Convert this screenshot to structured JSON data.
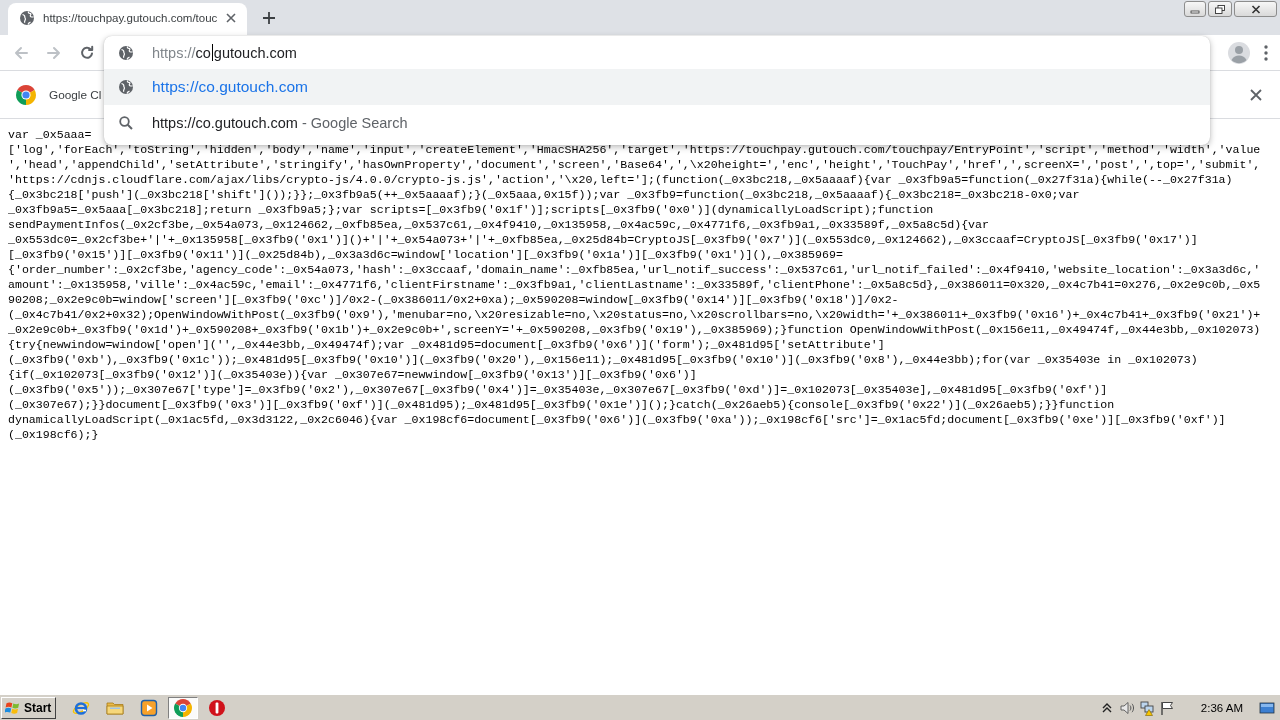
{
  "tabs": [
    {
      "title": "https://touchpay.gutouch.com/touc",
      "selected": true
    }
  ],
  "toolbar": {
    "nav_buttons": [
      {
        "kind": "back",
        "disabled": true
      },
      {
        "kind": "forward",
        "disabled": true
      },
      {
        "kind": "reload",
        "disabled": false
      }
    ]
  },
  "omnibox": {
    "scheme": "https://",
    "before_caret": "co",
    "after_caret": "gutouch.com",
    "suggestions": [
      {
        "kind": "url",
        "text": "https://co.gutouch.com",
        "selected": true
      },
      {
        "kind": "search",
        "text": "https://co.gutouch.com",
        "suffix": "- Google Search",
        "selected": false
      }
    ]
  },
  "infobar": {
    "text": "Google Cl"
  },
  "page": {
    "code_lines": [
      "var _0x5aaa=",
      "['log','forEach','toString','hidden','body','name','input','createElement','HmacSHA256','target','https://touchpay.gutouch.com/touchpay/EntryPoint','script','method','width','value",
      "','head','appendChild','setAttribute','stringify','hasOwnProperty','document','screen','Base64',',\\x20height=','enc','height','TouchPay','href',',screenX=','post',',top=','submit',",
      "'https://cdnjs.cloudflare.com/ajax/libs/crypto-js/4.0.0/crypto-js.js','action','\\x20,left='];(function(_0x3bc218,_0x5aaaaf){var _0x3fb9a5=function(_0x27f31a){while(--_0x27f31a)",
      "{_0x3bc218['push'](_0x3bc218['shift']());}};_0x3fb9a5(++_0x5aaaaf);}(_0x5aaa,0x15f));var _0x3fb9=function(_0x3bc218,_0x5aaaaf){_0x3bc218=_0x3bc218-0x0;var",
      "_0x3fb9a5=_0x5aaa[_0x3bc218];return _0x3fb9a5;};var scripts=[_0x3fb9('0x1f')];scripts[_0x3fb9('0x0')](dynamicallyLoadScript);function",
      "sendPaymentInfos(_0x2cf3be,_0x54a073,_0x124662,_0xfb85ea,_0x537c61,_0x4f9410,_0x135958,_0x4ac59c,_0x4771f6,_0x3fb9a1,_0x33589f,_0x5a8c5d){var",
      "_0x553dc0=_0x2cf3be+'|'+_0x135958[_0x3fb9('0x1')]()+'|'+_0x54a073+'|'+_0xfb85ea,_0x25d84b=CryptoJS[_0x3fb9('0x7')](_0x553dc0,_0x124662),_0x3ccaaf=CryptoJS[_0x3fb9('0x17')]",
      "[_0x3fb9('0x15')][_0x3fb9('0x11')](_0x25d84b),_0x3a3d6c=window['location'][_0x3fb9('0x1a')][_0x3fb9('0x1')](),_0x385969=",
      "{'order_number':_0x2cf3be,'agency_code':_0x54a073,'hash':_0x3ccaaf,'domain_name':_0xfb85ea,'url_notif_success':_0x537c61,'url_notif_failed':_0x4f9410,'website_location':_0x3a3d6c,'",
      "amount':_0x135958,'ville':_0x4ac59c,'email':_0x4771f6,'clientFirstname':_0x3fb9a1,'clientLastname':_0x33589f,'clientPhone':_0x5a8c5d},_0x386011=0x320,_0x4c7b41=0x276,_0x2e9c0b,_0x5",
      "90208;_0x2e9c0b=window['screen'][_0x3fb9('0xc')]/0x2-(_0x386011/0x2+0xa);_0x590208=window[_0x3fb9('0x14')][_0x3fb9('0x18')]/0x2-",
      "(_0x4c7b41/0x2+0x32);OpenWindowWithPost(_0x3fb9('0x9'),'menubar=no,\\x20resizable=no,\\x20status=no,\\x20scrollbars=no,\\x20width='+_0x386011+_0x3fb9('0x16')+_0x4c7b41+_0x3fb9('0x21')+",
      "_0x2e9c0b+_0x3fb9('0x1d')+_0x590208+_0x3fb9('0x1b')+_0x2e9c0b+',screenY='+_0x590208,_0x3fb9('0x19'),_0x385969);}function OpenWindowWithPost(_0x156e11,_0x49474f,_0x44e3bb,_0x102073)",
      "{try{newwindow=window['open']('',_0x44e3bb,_0x49474f);var _0x481d95=document[_0x3fb9('0x6')]('form');_0x481d95['setAttribute']",
      "(_0x3fb9('0xb'),_0x3fb9('0x1c'));_0x481d95[_0x3fb9('0x10')](_0x3fb9('0x20'),_0x156e11);_0x481d95[_0x3fb9('0x10')](_0x3fb9('0x8'),_0x44e3bb);for(var _0x35403e in _0x102073)",
      "{if(_0x102073[_0x3fb9('0x12')](_0x35403e)){var _0x307e67=newwindow[_0x3fb9('0x13')][_0x3fb9('0x6')]",
      "(_0x3fb9('0x5'));_0x307e67['type']=_0x3fb9('0x2'),_0x307e67[_0x3fb9('0x4')]=_0x35403e,_0x307e67[_0x3fb9('0xd')]=_0x102073[_0x35403e],_0x481d95[_0x3fb9('0xf')]",
      "(_0x307e67);}}document[_0x3fb9('0x3')][_0x3fb9('0xf')](_0x481d95);_0x481d95[_0x3fb9('0x1e')]();}catch(_0x26aeb5){console[_0x3fb9('0x22')](_0x26aeb5);}}function",
      "dynamicallyLoadScript(_0x1ac5fd,_0x3d3122,_0x2c6046){var _0x198cf6=document[_0x3fb9('0x6')](_0x3fb9('0xa'));_0x198cf6['src']=_0x1ac5fd;document[_0x3fb9('0xe')][_0x3fb9('0xf')]",
      "(_0x198cf6);}"
    ]
  },
  "taskbar": {
    "start_label": "Start",
    "apps": [
      {
        "kind": "e-logo",
        "selected": false
      },
      {
        "kind": "folder",
        "selected": false
      },
      {
        "kind": "play",
        "selected": false
      },
      {
        "kind": "round-logo",
        "selected": true
      },
      {
        "kind": "exclamation",
        "selected": false
      }
    ],
    "clock": "2:36 AM"
  }
}
